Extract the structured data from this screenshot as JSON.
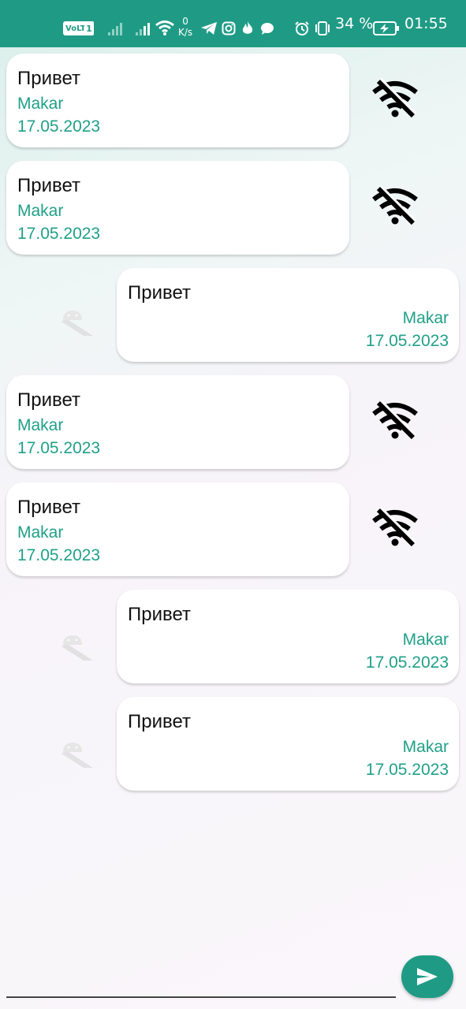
{
  "status_bar": {
    "volte": "VoLTE",
    "sim": "1",
    "speed_value": "0",
    "speed_unit": "K/s",
    "battery_percent": "34 %",
    "time": "01:55",
    "icons": [
      "signal-icon",
      "signal-icon-2",
      "wifi-icon",
      "telegram-icon",
      "instagram-icon",
      "flame-icon",
      "chat-icon",
      "alarm-icon",
      "vibrate-icon",
      "battery-charging-icon"
    ]
  },
  "messages": [
    {
      "side": "left",
      "text": "Привет",
      "author": "Makar",
      "date": "17.05.2023",
      "icon": "wifi-off-icon"
    },
    {
      "side": "left",
      "text": "Привет",
      "author": "Makar",
      "date": "17.05.2023",
      "icon": "wifi-off-icon"
    },
    {
      "side": "right",
      "text": "Привет",
      "author": "Makar",
      "date": "17.05.2023",
      "icon": "android-icon"
    },
    {
      "side": "left",
      "text": "Привет",
      "author": "Makar",
      "date": "17.05.2023",
      "icon": "wifi-off-icon"
    },
    {
      "side": "left",
      "text": "Привет",
      "author": "Makar",
      "date": "17.05.2023",
      "icon": "wifi-off-icon"
    },
    {
      "side": "right",
      "text": "Привет",
      "author": "Makar",
      "date": "17.05.2023",
      "icon": "android-icon"
    },
    {
      "side": "right",
      "text": "Привет",
      "author": "Makar",
      "date": "17.05.2023",
      "icon": "android-icon"
    }
  ],
  "composer": {
    "input_value": "",
    "send_icon": "send-icon"
  },
  "colors": {
    "accent": "#1f9b85",
    "name_date": "#20a088"
  }
}
